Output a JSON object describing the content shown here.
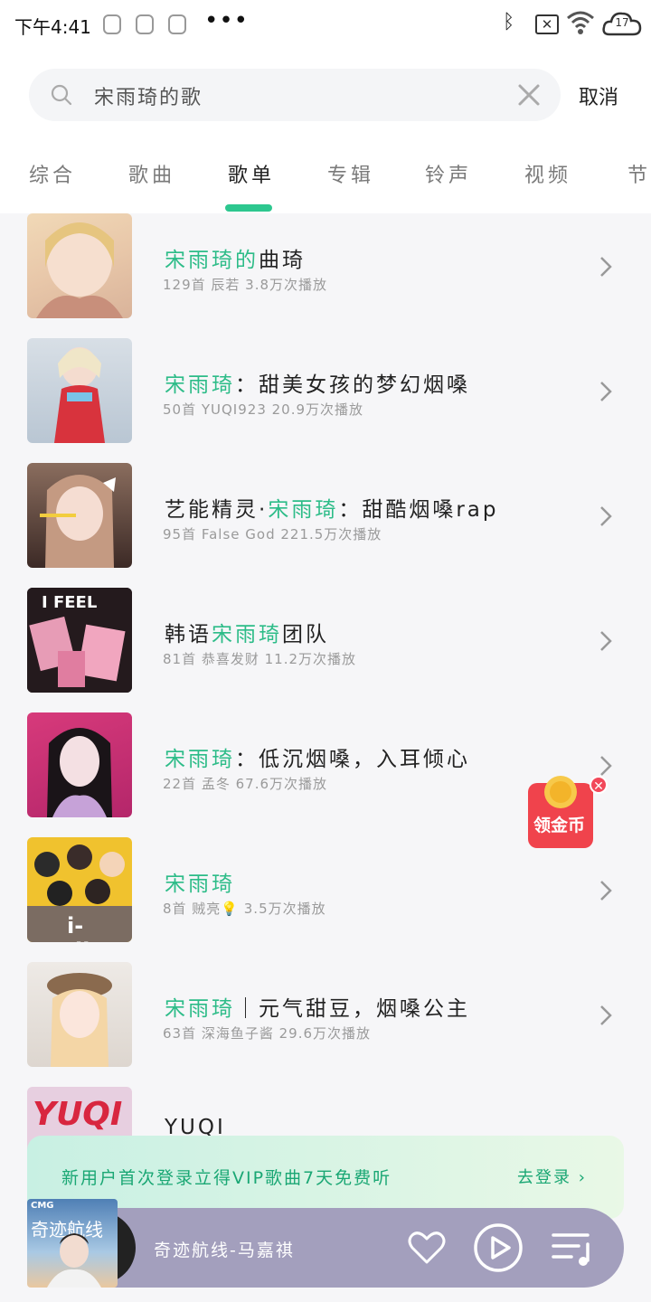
{
  "status_bar": {
    "time": "下午4:41",
    "notif_1": "",
    "notif_2": "",
    "notif_3": "",
    "more": "•••",
    "cloud_count": "17"
  },
  "search": {
    "value": "宋雨琦的歌",
    "cancel": "取消"
  },
  "tabs": [
    {
      "label": "综合"
    },
    {
      "label": "歌曲"
    },
    {
      "label": "歌单",
      "active": true
    },
    {
      "label": "专辑"
    },
    {
      "label": "铃声"
    },
    {
      "label": "视频"
    },
    {
      "label": "节"
    }
  ],
  "playlists": [
    {
      "title_hl": "宋雨琦的",
      "title_rest": "曲琦",
      "meta": "129首  辰若  3.8万次播放"
    },
    {
      "title_hl": "宋雨琦",
      "title_rest": "：甜美女孩的梦幻烟嗓",
      "meta": "50首  YUQI923  20.9万次播放"
    },
    {
      "title_pre": "艺能精灵·",
      "title_hl": "宋雨琦",
      "title_rest": "：甜酷烟嗓rap",
      "meta": "95首  False God  221.5万次播放"
    },
    {
      "title_pre": "韩语",
      "title_hl": "宋雨琦",
      "title_rest": "团队",
      "meta": "81首  恭喜发财  11.2万次播放"
    },
    {
      "title_hl": "宋雨琦",
      "title_rest": "：低沉烟嗓，入耳倾心",
      "meta": "22首  孟冬  67.6万次播放"
    },
    {
      "title_hl": "宋雨琦",
      "title_rest": "",
      "meta": "8首  贼亮💡  3.5万次播放"
    },
    {
      "title_hl": "宋雨琦",
      "title_rest": "｜元气甜豆，烟嗓公主",
      "meta": "63首  深海鱼子酱  29.6万次播放"
    },
    {
      "title_pre": "YUQI",
      "title_hl": "",
      "title_rest": "",
      "meta": ""
    }
  ],
  "cover_texts": {
    "c4": "I FEEL",
    "c6": "i-dle*",
    "c8": "YUQI"
  },
  "coin_badge": {
    "label": "领金币"
  },
  "login_banner": {
    "text": "新用户首次登录立得VIP歌曲7天免费听",
    "link": "去登录"
  },
  "player": {
    "cover_logo": "CMG",
    "cover_title": "奇迹航线",
    "title": "奇迹航线-马嘉祺"
  },
  "colors": {
    "accent": "#2dc78f",
    "player_bg": "#a39fbd"
  }
}
